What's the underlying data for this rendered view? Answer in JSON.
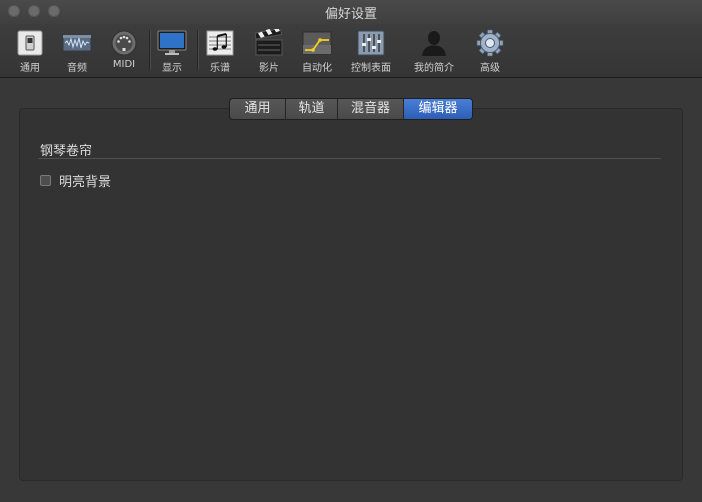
{
  "window": {
    "title": "偏好设置"
  },
  "toolbar": {
    "items": [
      {
        "id": "general",
        "label": "通用",
        "icon": "switch-icon"
      },
      {
        "id": "audio",
        "label": "音频",
        "icon": "waveform-icon"
      },
      {
        "id": "midi",
        "label": "MIDI",
        "icon": "midi-connector-icon"
      },
      {
        "id": "display",
        "label": "显示",
        "icon": "monitor-icon"
      },
      {
        "id": "score",
        "label": "乐谱",
        "icon": "music-notes-icon"
      },
      {
        "id": "movie",
        "label": "影片",
        "icon": "clapperboard-icon"
      },
      {
        "id": "automation",
        "label": "自动化",
        "icon": "automation-curve-icon"
      },
      {
        "id": "control-surfaces",
        "label": "控制表面",
        "icon": "faders-icon"
      },
      {
        "id": "my-info",
        "label": "我的简介",
        "icon": "person-silhouette-icon"
      },
      {
        "id": "advanced",
        "label": "高级",
        "icon": "gear-icon"
      }
    ]
  },
  "tabs": {
    "items": [
      {
        "label": "通用",
        "active": false
      },
      {
        "label": "轨道",
        "active": false
      },
      {
        "label": "混音器",
        "active": false
      },
      {
        "label": "编辑器",
        "active": true
      }
    ]
  },
  "section": {
    "title": "钢琴卷帘"
  },
  "options": {
    "bright_background": {
      "label": "明亮背景",
      "checked": false
    }
  }
}
